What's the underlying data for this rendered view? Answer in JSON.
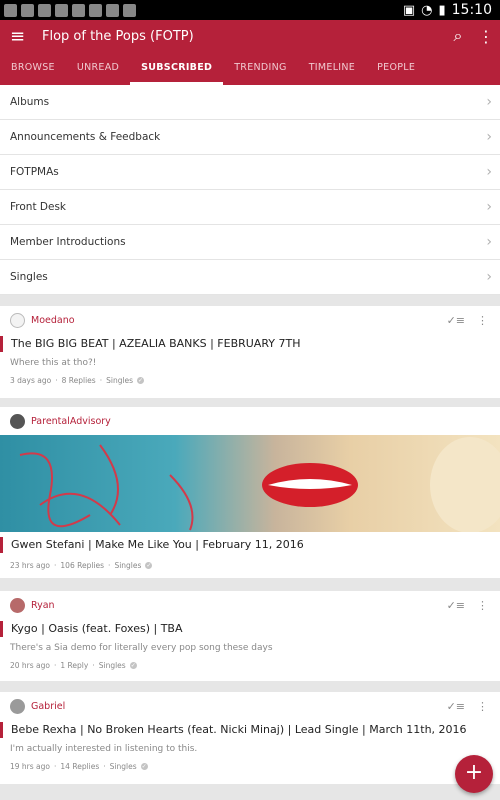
{
  "status": {
    "time": "15:10"
  },
  "app": {
    "title": "Flop of the Pops (FOTP)"
  },
  "tabs": [
    "BROWSE",
    "UNREAD",
    "SUBSCRIBED",
    "TRENDING",
    "TIMELINE",
    "PEOPLE"
  ],
  "forums": [
    "Albums",
    "Announcements & Feedback",
    "FOTPMAs",
    "Front Desk",
    "Member Introductions",
    "Singles"
  ],
  "topics": [
    {
      "author": "Moedano",
      "title": "The BIG BIG BEAT | AZEALIA BANKS | FEBRUARY 7TH",
      "snippet": "Where this at tho?!",
      "time": "3 days ago",
      "replies": "8 Replies",
      "forum": "Singles"
    },
    {
      "author": "ParentalAdvisory",
      "title": "Gwen Stefani | Make Me Like You | February 11, 2016",
      "snippet": "",
      "time": "23 hrs ago",
      "replies": "106 Replies",
      "forum": "Singles"
    },
    {
      "author": "Ryan",
      "title": "Kygo | Oasis (feat. Foxes) | TBA",
      "snippet": "There's a Sia demo for literally every pop song these days",
      "time": "20 hrs ago",
      "replies": "1 Reply",
      "forum": "Singles"
    },
    {
      "author": "Gabriel",
      "title": "Bebe Rexha | No Broken Hearts (feat. Nicki Minaj) | Lead Single | March 11th, 2016",
      "snippet": "I'm actually interested in listening to this.",
      "time": "19 hrs ago",
      "replies": "14 Replies",
      "forum": "Singles"
    }
  ],
  "colors": {
    "accent": "#b5213a"
  },
  "icons": {
    "menu": "menu-icon",
    "search": "search-icon",
    "more": "more-vert-icon",
    "mark_read": "mark-read-icon",
    "fab": "plus-icon"
  }
}
